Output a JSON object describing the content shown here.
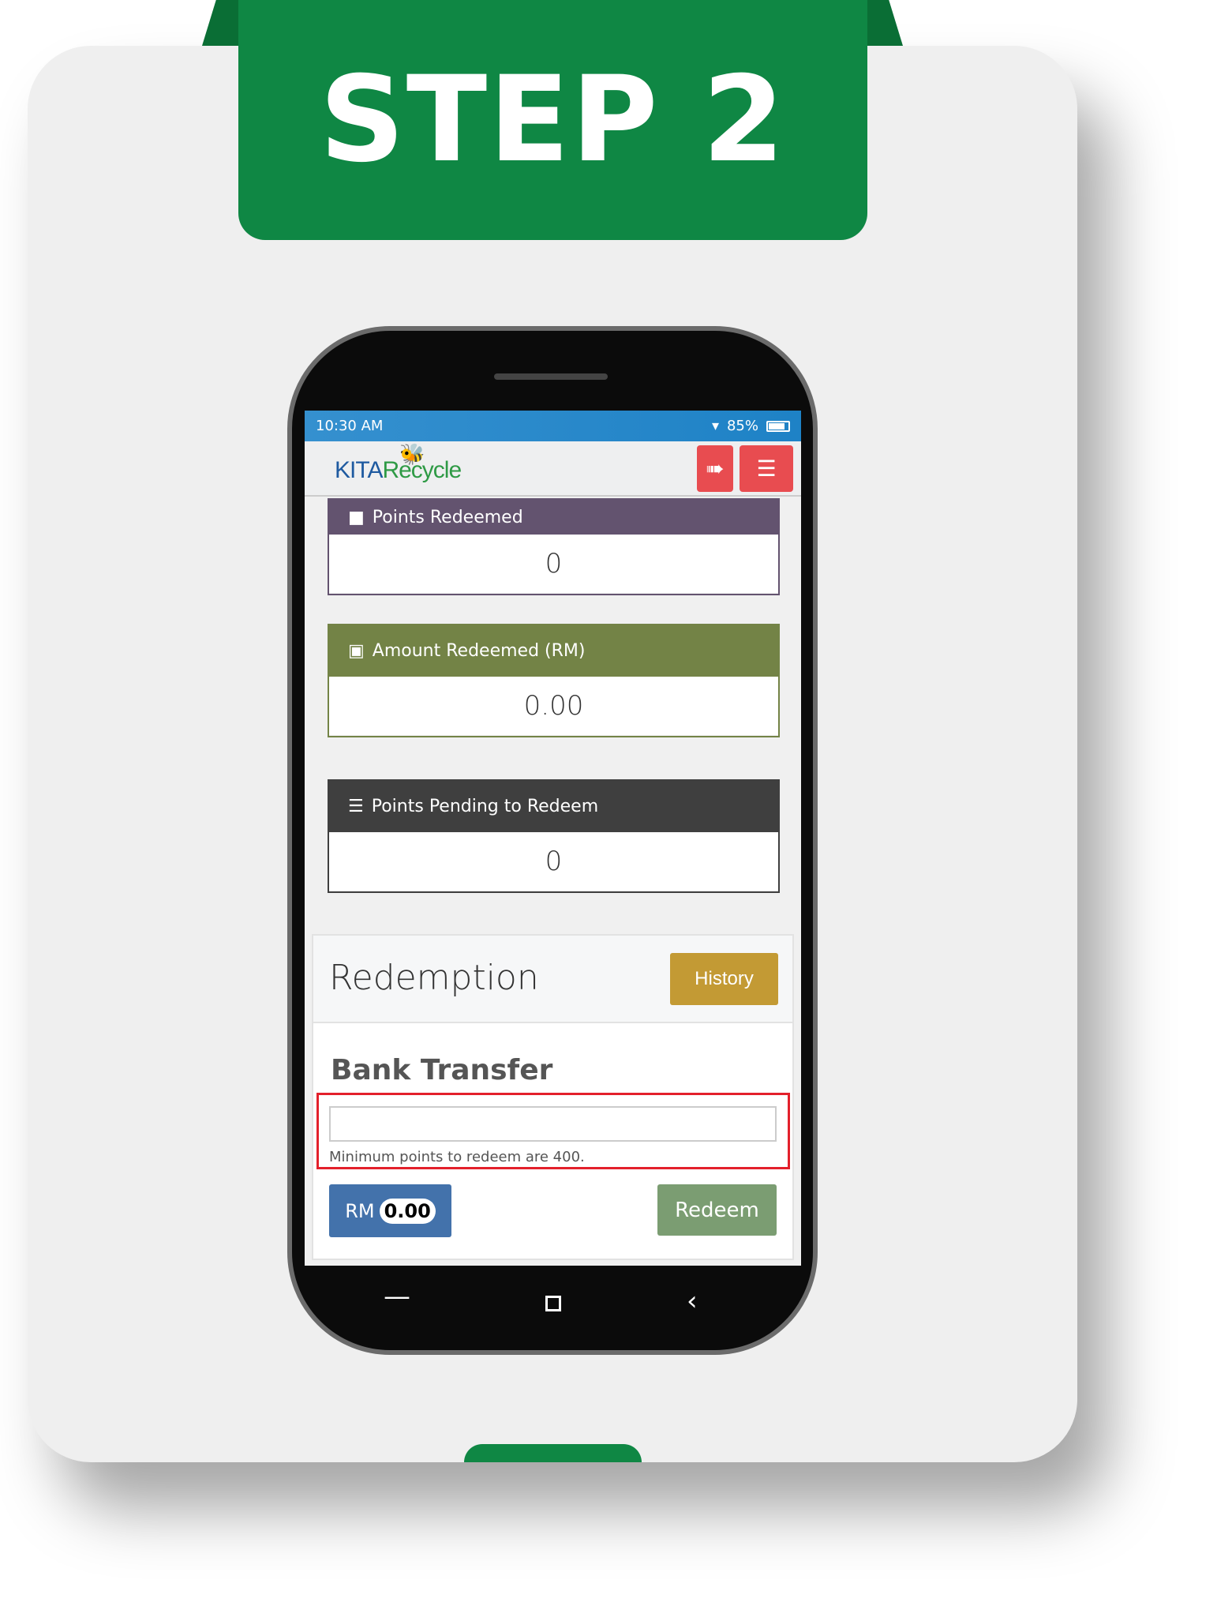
{
  "banner": {
    "title": "STEP 2"
  },
  "status_bar": {
    "time": "10:30 AM",
    "battery": "85%",
    "icons": [
      "wifi-icon",
      "battery-icon"
    ]
  },
  "header": {
    "logo": {
      "part1": "KITA",
      "part2": "Recycle"
    },
    "logout_icon": "sign-out-icon",
    "menu_icon": "hamburger-icon"
  },
  "stats": [
    {
      "label": "Points Redeemed",
      "value": "0",
      "color": "#63536f",
      "icon": "gift-icon"
    },
    {
      "label": "Amount Redeemed (RM)",
      "value": "0.00",
      "color": "#738346",
      "icon": "money-icon"
    },
    {
      "label": "Points Pending to Redeem",
      "value": "0",
      "color": "#3f3f3f",
      "icon": "list-icon"
    }
  ],
  "redemption": {
    "title": "Redemption",
    "history_label": "History",
    "section_title": "Bank Transfer",
    "input_value": "",
    "hint": "Minimum points to redeem are 400.",
    "rm_label": "RM",
    "rm_value": "0.00",
    "redeem_label": "Redeem"
  },
  "colors": {
    "brand_green": "#0f8744",
    "highlight": "#e3202b",
    "header_button": "#e84c50"
  }
}
